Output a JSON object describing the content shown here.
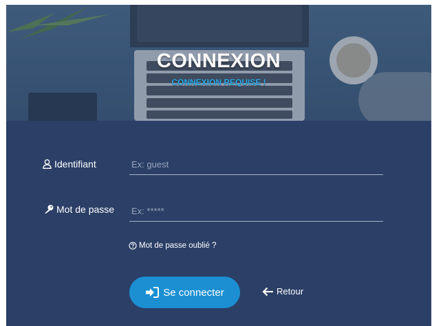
{
  "header": {
    "title": "CONNEXION",
    "subtitle": "CONNEXION REQUISE !"
  },
  "form": {
    "username": {
      "label": "Identifiant",
      "placeholder": "Ex: guest",
      "value": "",
      "icon": "user-icon"
    },
    "password": {
      "label": "Mot de passe",
      "placeholder": "Ex: *****",
      "value": "",
      "icon": "key-icon"
    },
    "forgot_label": "Mot de passe oublié ?",
    "forgot_icon": "question-circle-icon"
  },
  "actions": {
    "connect_label": "Se connecter",
    "connect_icon": "sign-in-icon",
    "back_label": "Retour",
    "back_icon": "arrow-left-icon"
  },
  "colors": {
    "panel": "#2b3f67",
    "accent": "#1b8fd2",
    "subtitle": "#29a8e6"
  }
}
